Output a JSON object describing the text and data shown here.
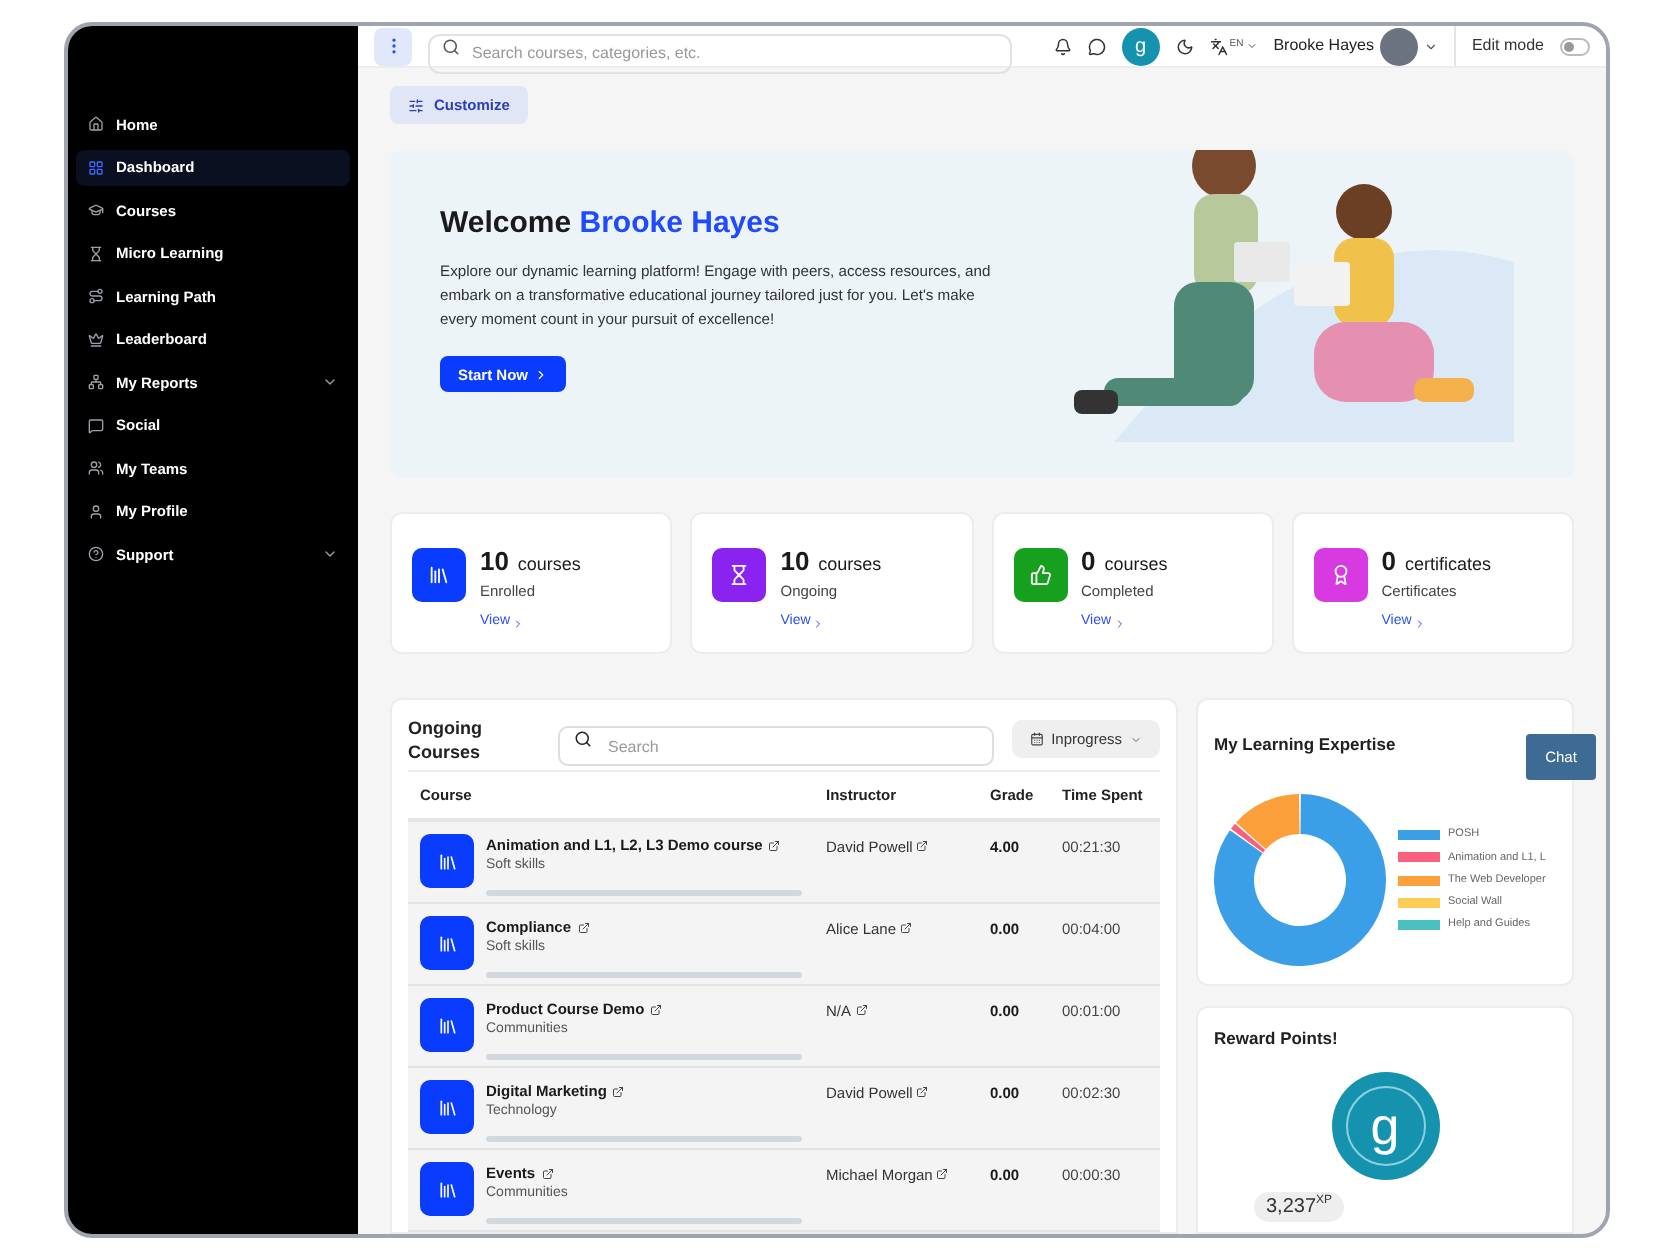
{
  "sidebar": {
    "items": [
      {
        "label": "Home",
        "selected": false,
        "expandable": false
      },
      {
        "label": "Dashboard",
        "selected": true,
        "expandable": false
      },
      {
        "label": "Courses",
        "selected": false,
        "expandable": false
      },
      {
        "label": "Micro Learning",
        "selected": false,
        "expandable": false
      },
      {
        "label": "Learning Path",
        "selected": false,
        "expandable": false
      },
      {
        "label": "Leaderboard",
        "selected": false,
        "expandable": false
      },
      {
        "label": "My Reports",
        "selected": false,
        "expandable": true
      },
      {
        "label": "Social",
        "selected": false,
        "expandable": false
      },
      {
        "label": "My Teams",
        "selected": false,
        "expandable": false
      },
      {
        "label": "My Profile",
        "selected": false,
        "expandable": false
      },
      {
        "label": "Support",
        "selected": false,
        "expandable": true
      }
    ]
  },
  "topbar": {
    "search": {
      "placeholder": "Search courses, categories, etc."
    },
    "brand_letter": "g",
    "language": "EN",
    "user_name": "Brooke Hayes",
    "edit_mode": {
      "label": "Edit mode",
      "on": false
    }
  },
  "customize_button": "Customize",
  "welcome": {
    "greeting": "Welcome",
    "name": "Brooke Hayes",
    "text": "Explore our dynamic learning platform! Engage with peers, access resources, and embark on a transformative educational journey tailored just for you. Let's make every moment count in your pursuit of excellence!",
    "button": "Start Now"
  },
  "stats": [
    {
      "kind": "books",
      "color": "#0a3cff",
      "count": "10",
      "unit": "courses",
      "label": "Enrolled",
      "link": "View"
    },
    {
      "kind": "hourglass",
      "color": "#8a22f0",
      "count": "10",
      "unit": "courses",
      "label": "Ongoing",
      "link": "View"
    },
    {
      "kind": "thumb",
      "color": "#16a01e",
      "count": "0",
      "unit": "courses",
      "label": "Completed",
      "link": "View"
    },
    {
      "kind": "certificate",
      "color": "#d63ae0",
      "count": "0",
      "unit": "certificates",
      "label": "Certificates",
      "link": "View"
    }
  ],
  "ongoing_courses": {
    "title": "Ongoing Courses",
    "search": {
      "placeholder": "Search"
    },
    "filter": "Inprogress",
    "columns": [
      "Course",
      "Instructor",
      "Grade",
      "Time Spent"
    ],
    "rows": [
      {
        "course": "Animation and L1, L2, L3 Demo course",
        "category": "Soft skills",
        "level": 0,
        "instructor": "David Powell",
        "grade": "4.00",
        "time": "00:21:30"
      },
      {
        "course": "Compliance",
        "category": "Soft skills",
        "level": 0,
        "instructor": "Alice Lane",
        "grade": "0.00",
        "time": "00:04:00"
      },
      {
        "course": "Product Course Demo",
        "category": "Communities",
        "level": 0,
        "instructor": "N/A",
        "grade": "0.00",
        "time": "00:01:00"
      },
      {
        "course": "Digital Marketing",
        "category": "Technology",
        "level": 0,
        "instructor": "David Powell",
        "grade": "0.00",
        "time": "00:02:30"
      },
      {
        "course": "Events",
        "category": "Communities",
        "level": 0,
        "instructor": "Michael Morgan",
        "grade": "0.00",
        "time": "00:00:30"
      }
    ]
  },
  "learning_expertise": {
    "title": "My Learning Expertise",
    "legend": [
      {
        "label": "POSH",
        "color": "#3b9fe8"
      },
      {
        "label": "Animation and L1, L",
        "color": "#f8607e"
      },
      {
        "label": "The Web Developer",
        "color": "#fb9f3a"
      },
      {
        "label": "Social Wall",
        "color": "#fdcc56"
      },
      {
        "label": "Help and Guides",
        "color": "#4bc0c0"
      }
    ]
  },
  "chat_button": "Chat",
  "reward_points": {
    "title": "Reward Points!",
    "letter": "g",
    "points": "3,237",
    "unit": "XP"
  }
}
